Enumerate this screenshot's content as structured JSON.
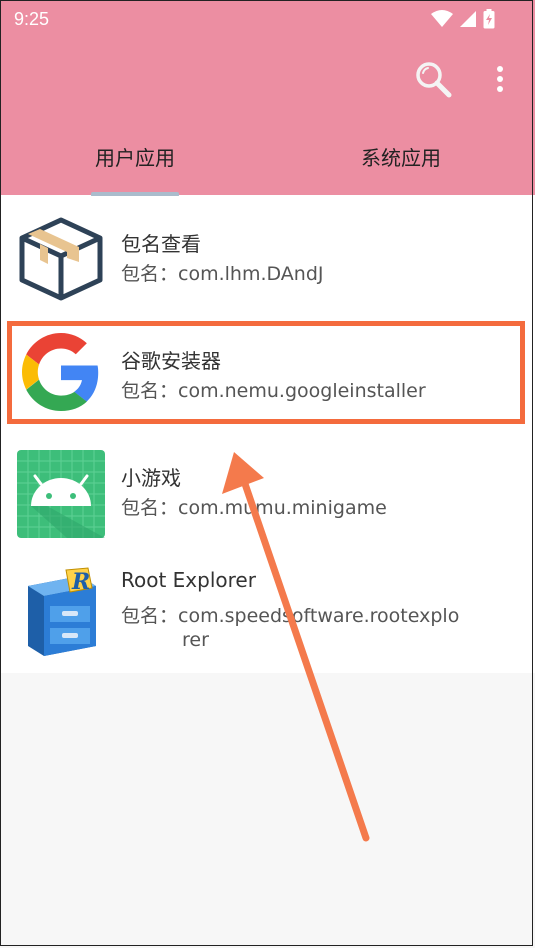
{
  "status_bar": {
    "time": "9:25"
  },
  "colors": {
    "appbar": "#EC8EA2",
    "highlight": "#F46B3D",
    "indicator": "#AABCCC"
  },
  "tabs": [
    {
      "label": "用户应用",
      "selected": true
    },
    {
      "label": "系统应用",
      "selected": false
    }
  ],
  "apps": [
    {
      "name": "包名查看",
      "pkg_label": "包名：",
      "pkg": "com.lhm.DAndJ",
      "icon": "package-box-icon"
    },
    {
      "name": "谷歌安装器",
      "pkg_label": "包名：",
      "pkg": "com.nemu.googleinstaller",
      "icon": "google-g-icon"
    },
    {
      "name": "小游戏",
      "pkg_label": "包名：",
      "pkg": "com.mumu.minigame",
      "icon": "android-icon"
    },
    {
      "name": "Root Explorer",
      "pkg_label": "包名：",
      "pkg": "com.speedsoftware.rootexplorer",
      "pkg_line1": "com.speedsoftware.rootexplo",
      "pkg_line2": "rer",
      "icon": "file-cabinet-icon"
    }
  ]
}
